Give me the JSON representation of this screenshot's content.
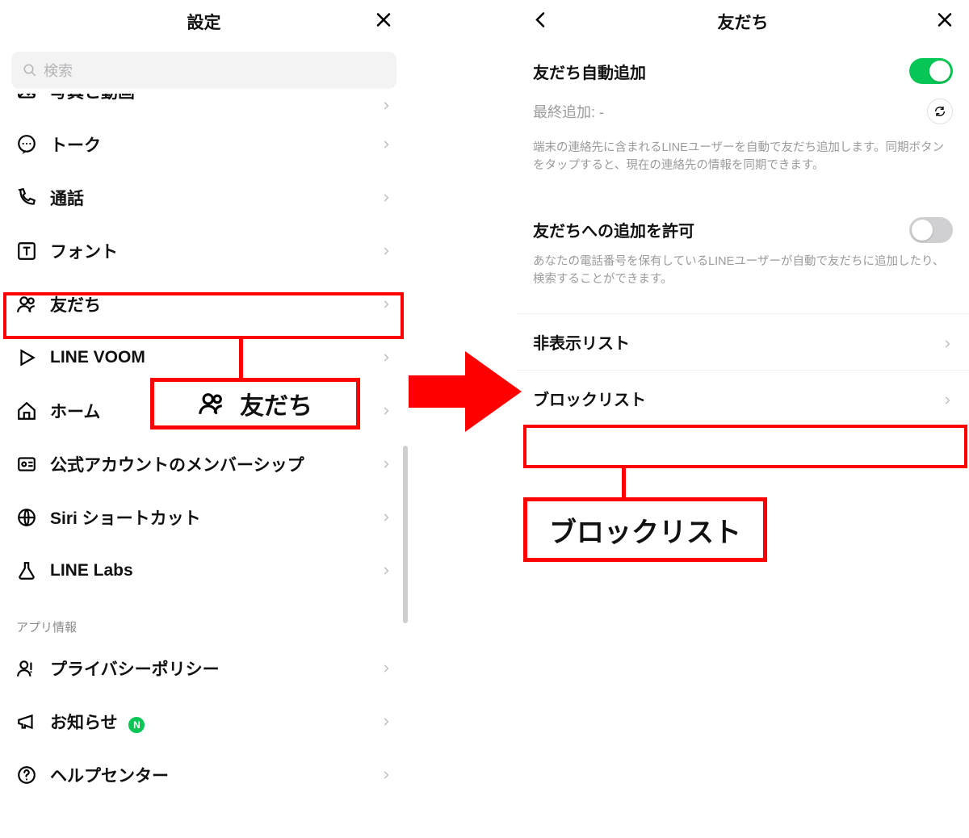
{
  "left": {
    "title": "設定",
    "search_placeholder": "検索",
    "items": [
      {
        "icon": "image",
        "label": "写真と動画"
      },
      {
        "icon": "chat",
        "label": "トーク"
      },
      {
        "icon": "phone",
        "label": "通話"
      },
      {
        "icon": "font",
        "label": "フォント"
      },
      {
        "icon": "friends",
        "label": "友だち"
      },
      {
        "icon": "play",
        "label": "LINE VOOM"
      },
      {
        "icon": "home",
        "label": "ホーム"
      },
      {
        "icon": "card",
        "label": "公式アカウントのメンバーシップ"
      },
      {
        "icon": "globe",
        "label": "Siri ショートカット"
      },
      {
        "icon": "flask",
        "label": "LINE Labs"
      }
    ],
    "section_app": "アプリ情報",
    "app_items": [
      {
        "icon": "privacy",
        "label": "プライバシーポリシー"
      },
      {
        "icon": "announce",
        "label": "お知らせ",
        "badge": "N"
      },
      {
        "icon": "help",
        "label": "ヘルプセンター"
      }
    ],
    "callout_label": "友だち"
  },
  "right": {
    "title": "友だち",
    "auto_add_label": "友だち自動追加",
    "auto_add_on": true,
    "last_add": "最終追加: -",
    "auto_add_desc": "端末の連絡先に含まれるLINEユーザーを自動で友だち追加します。同期ボタンをタップすると、現在の連絡先の情報を同期できます。",
    "allow_add_label": "友だちへの追加を許可",
    "allow_add_on": false,
    "allow_add_desc": "あなたの電話番号を保有しているLINEユーザーが自動で友だちに追加したり、検索することができます。",
    "rows": [
      {
        "label": "非表示リスト"
      },
      {
        "label": "ブロックリスト"
      }
    ],
    "callout_label": "ブロックリスト"
  },
  "colors": {
    "highlight": "#ff0000",
    "accent": "#06c755"
  }
}
